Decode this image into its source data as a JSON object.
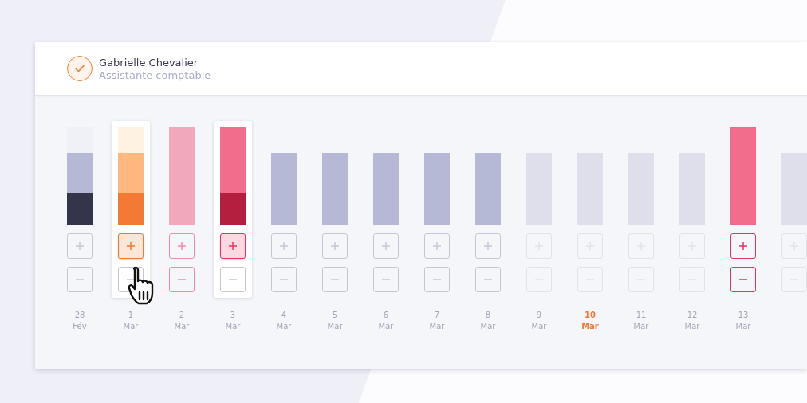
{
  "person": {
    "name": "Gabrielle Chevalier",
    "role": "Assistante comptable",
    "checked": true
  },
  "days": [
    {
      "day": "28",
      "month": "Fév",
      "highlighted": false,
      "today": false,
      "tall": true,
      "segments": [
        {
          "color": "#f0f0f8",
          "kind": "cap"
        },
        {
          "color": "#b6b9d6",
          "kind": "body"
        },
        {
          "color": "#35354a",
          "kind": "base"
        }
      ],
      "plus": {
        "color": "#c5c7d4",
        "selected": false
      },
      "minus": {
        "color": "#c5c7d4",
        "selected": false
      }
    },
    {
      "day": "1",
      "month": "Mar",
      "highlighted": true,
      "today": false,
      "tall": true,
      "segments": [
        {
          "color": "#fef2e2",
          "kind": "cap"
        },
        {
          "color": "#ffb880",
          "kind": "body"
        },
        {
          "color": "#f27a35",
          "kind": "base"
        }
      ],
      "plus": {
        "color": "#f07a30",
        "selected": true
      },
      "minus": {
        "color": "#c5c7d4",
        "selected": false
      }
    },
    {
      "day": "2",
      "month": "Mar",
      "highlighted": false,
      "today": false,
      "tall": true,
      "segments": [
        {
          "color": "#f2a8bc",
          "kind": "body"
        }
      ],
      "plus": {
        "color": "#f08ca8",
        "selected": false
      },
      "minus": {
        "color": "#f08ca8",
        "selected": false
      }
    },
    {
      "day": "3",
      "month": "Mar",
      "highlighted": true,
      "today": false,
      "tall": true,
      "segments": [
        {
          "color": "#f26d8c",
          "kind": "body"
        },
        {
          "color": "#b51f3f",
          "kind": "base"
        }
      ],
      "plus": {
        "color": "#e23660",
        "selected": true
      },
      "minus": {
        "color": "#c5c7d4",
        "selected": false
      }
    },
    {
      "day": "4",
      "month": "Mar",
      "highlighted": false,
      "today": false,
      "tall": false,
      "segments": [
        {
          "color": "#b6b9d6",
          "kind": "body"
        }
      ],
      "plus": {
        "color": "#c5c7d4",
        "selected": false
      },
      "minus": {
        "color": "#c5c7d4",
        "selected": false
      }
    },
    {
      "day": "5",
      "month": "Mar",
      "highlighted": false,
      "today": false,
      "tall": false,
      "segments": [
        {
          "color": "#b6b9d6",
          "kind": "body"
        }
      ],
      "plus": {
        "color": "#c5c7d4",
        "selected": false
      },
      "minus": {
        "color": "#c5c7d4",
        "selected": false
      }
    },
    {
      "day": "6",
      "month": "Mar",
      "highlighted": false,
      "today": false,
      "tall": false,
      "segments": [
        {
          "color": "#b6b9d6",
          "kind": "body"
        }
      ],
      "plus": {
        "color": "#c5c7d4",
        "selected": false
      },
      "minus": {
        "color": "#c5c7d4",
        "selected": false
      }
    },
    {
      "day": "7",
      "month": "Mar",
      "highlighted": false,
      "today": false,
      "tall": false,
      "segments": [
        {
          "color": "#b6b9d6",
          "kind": "body"
        }
      ],
      "plus": {
        "color": "#c5c7d4",
        "selected": false
      },
      "minus": {
        "color": "#c5c7d4",
        "selected": false
      }
    },
    {
      "day": "8",
      "month": "Mar",
      "highlighted": false,
      "today": false,
      "tall": false,
      "segments": [
        {
          "color": "#b6b9d6",
          "kind": "body"
        }
      ],
      "plus": {
        "color": "#c5c7d4",
        "selected": false
      },
      "minus": {
        "color": "#c5c7d4",
        "selected": false
      }
    },
    {
      "day": "9",
      "month": "Mar",
      "highlighted": false,
      "today": false,
      "tall": false,
      "segments": [
        {
          "color": "#dedfeb",
          "kind": "body"
        }
      ],
      "plus": {
        "color": "#e2e3ea",
        "selected": false
      },
      "minus": {
        "color": "#e2e3ea",
        "selected": false
      }
    },
    {
      "day": "10",
      "month": "Mar",
      "highlighted": false,
      "today": true,
      "tall": false,
      "segments": [
        {
          "color": "#dedfeb",
          "kind": "body"
        }
      ],
      "plus": {
        "color": "#e2e3ea",
        "selected": false
      },
      "minus": {
        "color": "#e2e3ea",
        "selected": false
      }
    },
    {
      "day": "11",
      "month": "Mar",
      "highlighted": false,
      "today": false,
      "tall": false,
      "segments": [
        {
          "color": "#dedfeb",
          "kind": "body"
        }
      ],
      "plus": {
        "color": "#e2e3ea",
        "selected": false
      },
      "minus": {
        "color": "#e2e3ea",
        "selected": false
      }
    },
    {
      "day": "12",
      "month": "Mar",
      "highlighted": false,
      "today": false,
      "tall": false,
      "segments": [
        {
          "color": "#dedfeb",
          "kind": "body"
        }
      ],
      "plus": {
        "color": "#e2e3ea",
        "selected": false
      },
      "minus": {
        "color": "#e2e3ea",
        "selected": false
      }
    },
    {
      "day": "13",
      "month": "Mar",
      "highlighted": false,
      "today": false,
      "tall": true,
      "segments": [
        {
          "color": "#f26d8c",
          "kind": "body"
        }
      ],
      "plus": {
        "color": "#e23660",
        "selected": false
      },
      "minus": {
        "color": "#e23660",
        "selected": false
      }
    },
    {
      "highlighted": false,
      "tall": false,
      "segments": [
        {
          "color": "#dedfeb",
          "kind": "body"
        }
      ],
      "plus": {
        "color": "#e2e3ea",
        "selected": false
      },
      "minus": {
        "color": "#e2e3ea",
        "selected": false
      }
    }
  ]
}
